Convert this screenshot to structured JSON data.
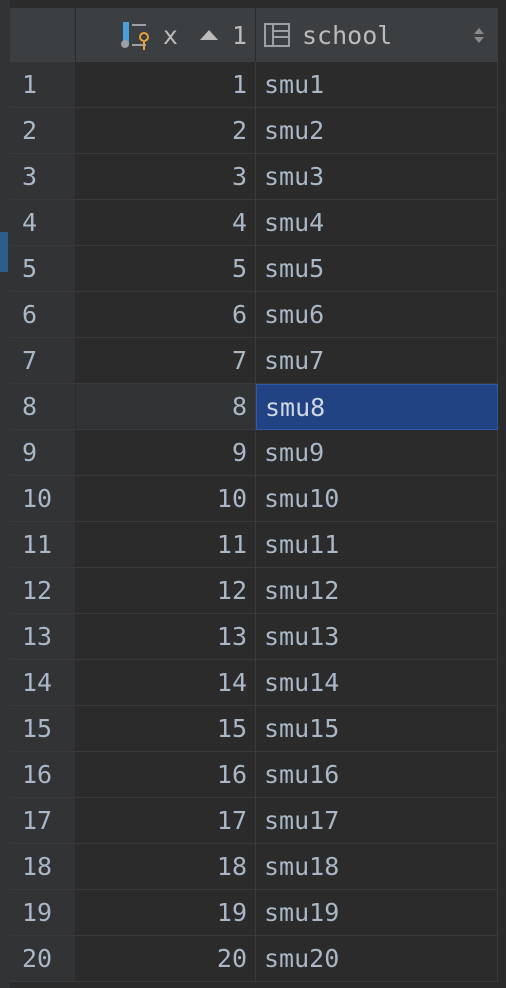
{
  "header": {
    "column_x_label": "x",
    "column_x_sort_order": "1",
    "column_school_label": "school"
  },
  "selected_row_index": 7,
  "rows": [
    {
      "num": "1",
      "x": "1",
      "school": "smu1"
    },
    {
      "num": "2",
      "x": "2",
      "school": "smu2"
    },
    {
      "num": "3",
      "x": "3",
      "school": "smu3"
    },
    {
      "num": "4",
      "x": "4",
      "school": "smu4"
    },
    {
      "num": "5",
      "x": "5",
      "school": "smu5"
    },
    {
      "num": "6",
      "x": "6",
      "school": "smu6"
    },
    {
      "num": "7",
      "x": "7",
      "school": "smu7"
    },
    {
      "num": "8",
      "x": "8",
      "school": "smu8"
    },
    {
      "num": "9",
      "x": "9",
      "school": "smu9"
    },
    {
      "num": "10",
      "x": "10",
      "school": "smu10"
    },
    {
      "num": "11",
      "x": "11",
      "school": "smu11"
    },
    {
      "num": "12",
      "x": "12",
      "school": "smu12"
    },
    {
      "num": "13",
      "x": "13",
      "school": "smu13"
    },
    {
      "num": "14",
      "x": "14",
      "school": "smu14"
    },
    {
      "num": "15",
      "x": "15",
      "school": "smu15"
    },
    {
      "num": "16",
      "x": "16",
      "school": "smu16"
    },
    {
      "num": "17",
      "x": "17",
      "school": "smu17"
    },
    {
      "num": "18",
      "x": "18",
      "school": "smu18"
    },
    {
      "num": "19",
      "x": "19",
      "school": "smu19"
    },
    {
      "num": "20",
      "x": "20",
      "school": "smu20"
    }
  ],
  "icons": {
    "x_column_icon": "primary-key-column-icon",
    "school_column_icon": "table-column-icon",
    "x_sort": "sort-ascending-icon",
    "school_sort": "sort-both-icon"
  },
  "colors": {
    "background": "#2b2b2b",
    "header_bg": "#3c3f41",
    "selection": "#214283",
    "key_accent": "#e6a23c",
    "column_accent": "#4a9fd8"
  }
}
